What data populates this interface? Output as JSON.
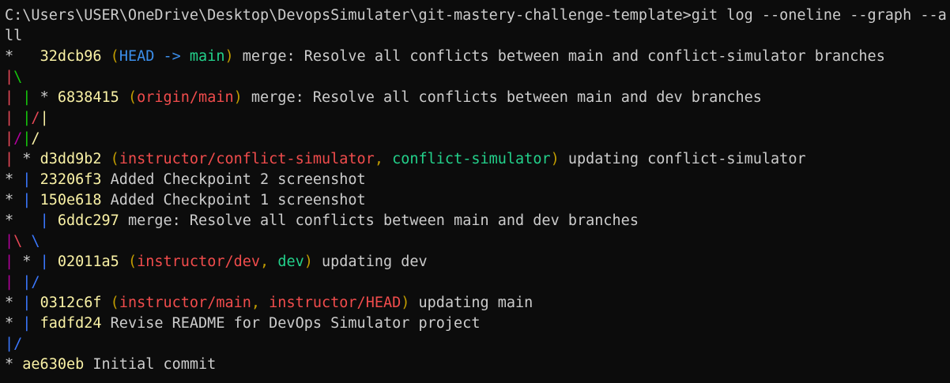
{
  "terminal": {
    "colors": {
      "default": "#cccccc",
      "hash": "#f9f1a5",
      "paren": "#c19c00",
      "head": "#3b8eea",
      "local_branch": "#23d18b",
      "remote_branch": "#f14c4c",
      "graph_red": "#e74856",
      "graph_green": "#16c60c",
      "graph_yellow": "#f9f1a5",
      "graph_blue": "#3b78ff",
      "graph_magenta": "#b4009e"
    },
    "lines": [
      {
        "segs": [
          {
            "t": "C:\\Users\\USER\\OneDrive\\Desktop\\DevopsSimulater\\git-mastery-challenge-template>git log --oneline --graph --a",
            "c": "#cccccc"
          }
        ]
      },
      {
        "segs": [
          {
            "t": "ll",
            "c": "#cccccc"
          }
        ]
      },
      {
        "segs": [
          {
            "t": "*   ",
            "c": "#cccccc"
          },
          {
            "t": "32dcb96",
            "c": "#f9f1a5"
          },
          {
            "t": " (",
            "c": "#c19c00"
          },
          {
            "t": "HEAD -> ",
            "c": "#3b8eea"
          },
          {
            "t": "main",
            "c": "#23d18b"
          },
          {
            "t": ")",
            "c": "#c19c00"
          },
          {
            "t": " merge: Resolve all conflicts between main and conflict-simulator branches",
            "c": "#cccccc"
          }
        ]
      },
      {
        "segs": [
          {
            "t": "|",
            "c": "#e74856"
          },
          {
            "t": "\\",
            "c": "#16c60c"
          }
        ]
      },
      {
        "segs": [
          {
            "t": "| ",
            "c": "#e74856"
          },
          {
            "t": "| ",
            "c": "#16c60c"
          },
          {
            "t": "* ",
            "c": "#cccccc"
          },
          {
            "t": "6838415",
            "c": "#f9f1a5"
          },
          {
            "t": " (",
            "c": "#c19c00"
          },
          {
            "t": "origin/main",
            "c": "#f14c4c"
          },
          {
            "t": ")",
            "c": "#c19c00"
          },
          {
            "t": " merge: Resolve all conflicts between main and dev branches",
            "c": "#cccccc"
          }
        ]
      },
      {
        "segs": [
          {
            "t": "| ",
            "c": "#e74856"
          },
          {
            "t": "|",
            "c": "#16c60c"
          },
          {
            "t": "/",
            "c": "#e74856"
          },
          {
            "t": "|",
            "c": "#f9f1a5"
          }
        ]
      },
      {
        "segs": [
          {
            "t": "|",
            "c": "#e74856"
          },
          {
            "t": "/",
            "c": "#b4009e"
          },
          {
            "t": "|",
            "c": "#16c60c"
          },
          {
            "t": "/",
            "c": "#f9f1a5"
          }
        ]
      },
      {
        "segs": [
          {
            "t": "| ",
            "c": "#e74856"
          },
          {
            "t": "* ",
            "c": "#cccccc"
          },
          {
            "t": "d3dd9b2",
            "c": "#f9f1a5"
          },
          {
            "t": " (",
            "c": "#c19c00"
          },
          {
            "t": "instructor/conflict-simulator",
            "c": "#f14c4c"
          },
          {
            "t": ", ",
            "c": "#c19c00"
          },
          {
            "t": "conflict-simulator",
            "c": "#23d18b"
          },
          {
            "t": ")",
            "c": "#c19c00"
          },
          {
            "t": " updating conflict-simulator",
            "c": "#cccccc"
          }
        ]
      },
      {
        "segs": [
          {
            "t": "* ",
            "c": "#cccccc"
          },
          {
            "t": "| ",
            "c": "#3b78ff"
          },
          {
            "t": "23206f3",
            "c": "#f9f1a5"
          },
          {
            "t": " Added Checkpoint 2 screenshot",
            "c": "#cccccc"
          }
        ]
      },
      {
        "segs": [
          {
            "t": "* ",
            "c": "#cccccc"
          },
          {
            "t": "| ",
            "c": "#3b78ff"
          },
          {
            "t": "150e618",
            "c": "#f9f1a5"
          },
          {
            "t": " Added Checkpoint 1 screenshot",
            "c": "#cccccc"
          }
        ]
      },
      {
        "segs": [
          {
            "t": "*   ",
            "c": "#cccccc"
          },
          {
            "t": "| ",
            "c": "#3b78ff"
          },
          {
            "t": "6ddc297",
            "c": "#f9f1a5"
          },
          {
            "t": " merge: Resolve all conflicts between main and dev branches",
            "c": "#cccccc"
          }
        ]
      },
      {
        "segs": [
          {
            "t": "|",
            "c": "#b4009e"
          },
          {
            "t": "\\ ",
            "c": "#e74856"
          },
          {
            "t": "\\",
            "c": "#3b78ff"
          }
        ]
      },
      {
        "segs": [
          {
            "t": "| ",
            "c": "#b4009e"
          },
          {
            "t": "* ",
            "c": "#cccccc"
          },
          {
            "t": "| ",
            "c": "#3b78ff"
          },
          {
            "t": "02011a5",
            "c": "#f9f1a5"
          },
          {
            "t": " (",
            "c": "#c19c00"
          },
          {
            "t": "instructor/dev",
            "c": "#f14c4c"
          },
          {
            "t": ", ",
            "c": "#c19c00"
          },
          {
            "t": "dev",
            "c": "#23d18b"
          },
          {
            "t": ")",
            "c": "#c19c00"
          },
          {
            "t": " updating dev",
            "c": "#cccccc"
          }
        ]
      },
      {
        "segs": [
          {
            "t": "| ",
            "c": "#b4009e"
          },
          {
            "t": "|/",
            "c": "#3b78ff"
          }
        ]
      },
      {
        "segs": [
          {
            "t": "* ",
            "c": "#cccccc"
          },
          {
            "t": "| ",
            "c": "#3b78ff"
          },
          {
            "t": "0312c6f",
            "c": "#f9f1a5"
          },
          {
            "t": " (",
            "c": "#c19c00"
          },
          {
            "t": "instructor/main",
            "c": "#f14c4c"
          },
          {
            "t": ", ",
            "c": "#c19c00"
          },
          {
            "t": "instructor/HEAD",
            "c": "#f14c4c"
          },
          {
            "t": ")",
            "c": "#c19c00"
          },
          {
            "t": " updating main",
            "c": "#cccccc"
          }
        ]
      },
      {
        "segs": [
          {
            "t": "* ",
            "c": "#cccccc"
          },
          {
            "t": "| ",
            "c": "#3b78ff"
          },
          {
            "t": "fadfd24",
            "c": "#f9f1a5"
          },
          {
            "t": " Revise README for DevOps Simulator project",
            "c": "#cccccc"
          }
        ]
      },
      {
        "segs": [
          {
            "t": "|/",
            "c": "#3b78ff"
          }
        ]
      },
      {
        "segs": [
          {
            "t": "* ",
            "c": "#cccccc"
          },
          {
            "t": "ae630eb",
            "c": "#f9f1a5"
          },
          {
            "t": " Initial commit",
            "c": "#cccccc"
          }
        ]
      }
    ]
  }
}
